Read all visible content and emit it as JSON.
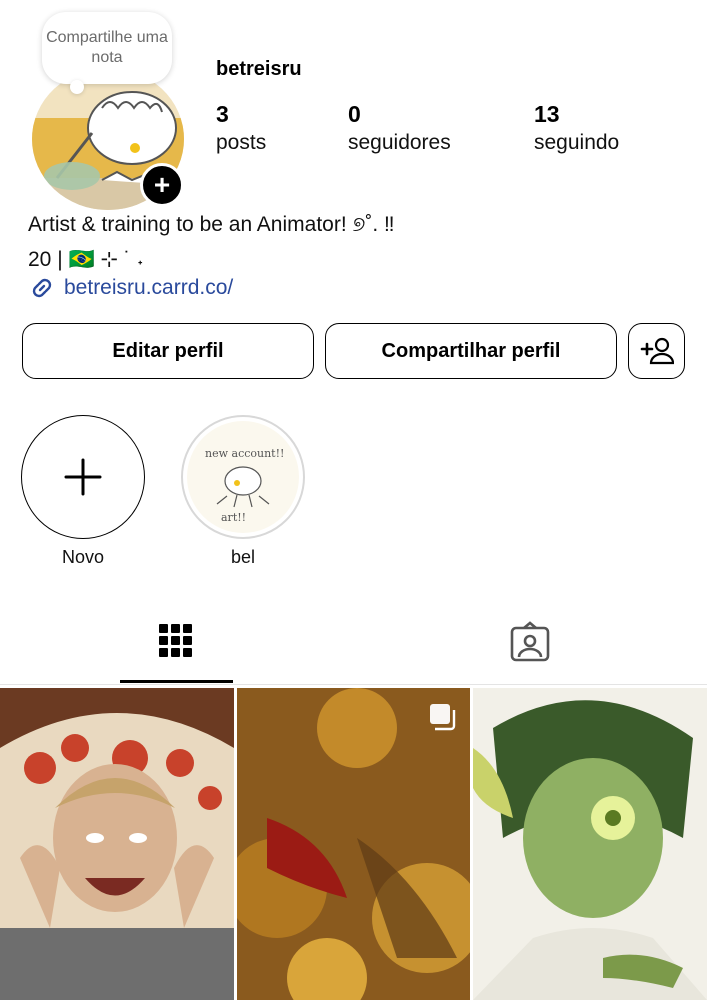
{
  "profile": {
    "note": "Compartilhe uma nota",
    "username": "betreisru",
    "stats": [
      {
        "value": "3",
        "label": "posts"
      },
      {
        "value": "0",
        "label": "seguidores"
      },
      {
        "value": "13",
        "label": "seguindo"
      }
    ],
    "bio_line1": "Artist & training to be an Animator! ୭˚. ‼",
    "bio_line2": "20 | 🇧🇷 ⊹ ˙ ˖",
    "link": "betreisru.carrd.co/"
  },
  "actions": {
    "edit": "Editar perfil",
    "share": "Compartilhar perfil"
  },
  "highlights": [
    {
      "label": "Novo"
    },
    {
      "label": "bel",
      "cover_text_top": "new account!!",
      "cover_text_bottom": "art!!"
    }
  ],
  "tabs": {
    "active": "grid",
    "items": [
      "grid-icon",
      "tagged-icon"
    ]
  },
  "colors": {
    "link": "#2a4a9c",
    "text": "#000000"
  }
}
